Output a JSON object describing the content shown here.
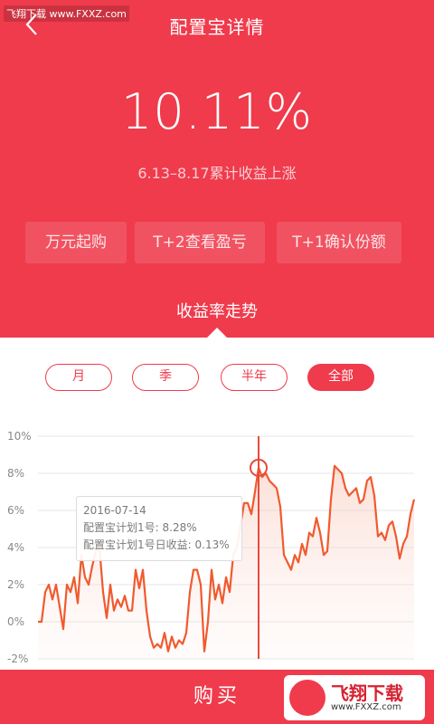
{
  "watermark_top": "飞翔下载 www.FXXZ.com",
  "header": {
    "title": "配置宝详情"
  },
  "hero": {
    "rate": "10.11%",
    "subtitle": "6.13–8.17累计收益上涨"
  },
  "tags": [
    "万元起购",
    "T+2查看盈亏",
    "T+1确认份额"
  ],
  "trend_title": "收益率走势",
  "periods": [
    {
      "label": "月"
    },
    {
      "label": "季"
    },
    {
      "label": "半年"
    },
    {
      "label": "全部",
      "active": true
    }
  ],
  "tooltip": {
    "date": "2016-07-14",
    "line1": "配置宝计划1号: 8.28%",
    "line2": "配置宝计划1号日收益: 0.13%"
  },
  "chart_data": {
    "type": "area",
    "ylabels": [
      "10%",
      "8%",
      "6%",
      "4%",
      "2%",
      "0%",
      "-2%"
    ],
    "ylim": [
      -2,
      10
    ],
    "color": "#f05a2e",
    "values": [
      0.0,
      0.0,
      1.6,
      2.0,
      1.2,
      2.0,
      0.8,
      -0.4,
      2.0,
      1.6,
      2.4,
      1.0,
      3.6,
      2.4,
      2.0,
      3.0,
      3.8,
      4.0,
      1.6,
      0.2,
      2.0,
      0.6,
      1.2,
      0.8,
      1.4,
      0.6,
      0.6,
      2.8,
      1.8,
      2.8,
      0.6,
      -0.8,
      -1.4,
      -1.2,
      -1.4,
      -0.6,
      -1.6,
      -0.8,
      -1.4,
      -1.0,
      -1.2,
      -0.6,
      1.6,
      2.8,
      2.8,
      2.0,
      -1.6,
      0.0,
      2.8,
      1.2,
      2.0,
      1.0,
      2.4,
      1.6,
      3.6,
      4.0,
      5.2,
      6.4,
      6.4,
      5.8,
      7.0,
      8.3,
      7.8,
      8.0,
      7.6,
      7.4,
      7.2,
      6.2,
      3.6,
      3.2,
      2.8,
      3.6,
      3.2,
      4.2,
      3.6,
      4.8,
      4.6,
      5.6,
      4.8,
      3.6,
      3.8,
      6.6,
      8.4,
      8.2,
      8.0,
      7.2,
      6.8,
      7.0,
      7.2,
      6.4,
      6.6,
      7.6,
      7.8,
      6.8,
      4.6,
      4.8,
      4.4,
      5.2,
      5.4,
      4.6,
      3.4,
      4.2,
      4.6,
      5.8,
      6.6
    ],
    "marker_index": 61
  },
  "bottom": {
    "buy_label": "购买"
  },
  "watermark_bottom": {
    "name": "飞翔下载",
    "url": "www.FXXZ.com"
  }
}
